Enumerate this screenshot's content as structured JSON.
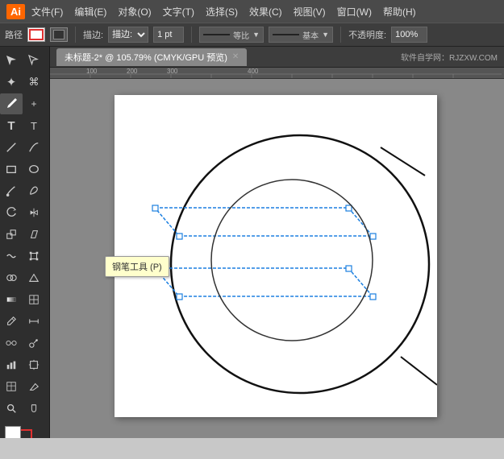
{
  "app": {
    "logo": "Ai",
    "title_bar_bg": "#4a4a4a"
  },
  "menu": {
    "items": [
      "文件(F)",
      "编辑(E)",
      "对象(O)",
      "文字(T)",
      "选择(S)",
      "效果(C)",
      "视图(V)",
      "窗口(W)",
      "帮助(H)"
    ]
  },
  "toolbar": {
    "label_path": "路径",
    "stroke_color": "红色",
    "fill_label": "描边:",
    "stroke_width": "1 pt",
    "equal_label": "等比",
    "base_label": "基本",
    "opacity_label": "不透明度:",
    "opacity_value": "100%"
  },
  "document": {
    "tab_label": "未标题-2* @ 105.79% (CMYK/GPU 预览)",
    "site_info": "软件自学网：RJZXW.COM"
  },
  "tooltip": {
    "text": "钢笔工具 (P)"
  },
  "tools": [
    {
      "name": "selection-tool",
      "icon": "▶",
      "active": false
    },
    {
      "name": "direct-selection-tool",
      "icon": "↖",
      "active": false
    },
    {
      "name": "magic-wand-tool",
      "icon": "✦",
      "active": false
    },
    {
      "name": "lasso-tool",
      "icon": "⊙",
      "active": false
    },
    {
      "name": "pen-tool",
      "icon": "✒",
      "active": true
    },
    {
      "name": "type-tool",
      "icon": "T",
      "active": false
    },
    {
      "name": "line-tool",
      "icon": "/",
      "active": false
    },
    {
      "name": "rectangle-tool",
      "icon": "□",
      "active": false
    },
    {
      "name": "paintbrush-tool",
      "icon": "♦",
      "active": false
    },
    {
      "name": "pencil-tool",
      "icon": "✏",
      "active": false
    },
    {
      "name": "rotate-tool",
      "icon": "↻",
      "active": false
    },
    {
      "name": "scale-tool",
      "icon": "⤢",
      "active": false
    },
    {
      "name": "warp-tool",
      "icon": "~",
      "active": false
    },
    {
      "name": "free-transform-tool",
      "icon": "⊞",
      "active": false
    },
    {
      "name": "shape-builder-tool",
      "icon": "⊕",
      "active": false
    },
    {
      "name": "perspective-tool",
      "icon": "⊿",
      "active": false
    },
    {
      "name": "gradient-tool",
      "icon": "■",
      "active": false
    },
    {
      "name": "eyedropper-tool",
      "icon": "⊘",
      "active": false
    },
    {
      "name": "blend-tool",
      "icon": "∞",
      "active": false
    },
    {
      "name": "symbol-tool",
      "icon": "⊛",
      "active": false
    },
    {
      "name": "column-chart-tool",
      "icon": "▐",
      "active": false
    },
    {
      "name": "artboard-tool",
      "icon": "⊡",
      "active": false
    },
    {
      "name": "slice-tool",
      "icon": "⊟",
      "active": false
    },
    {
      "name": "eraser-tool",
      "icon": "◻",
      "active": false
    },
    {
      "name": "zoom-tool",
      "icon": "🔍",
      "active": false
    },
    {
      "name": "hand-tool",
      "icon": "✋",
      "active": false
    },
    {
      "name": "fill-color",
      "icon": "■",
      "active": false
    },
    {
      "name": "stroke-color",
      "icon": "□",
      "active": false
    }
  ]
}
